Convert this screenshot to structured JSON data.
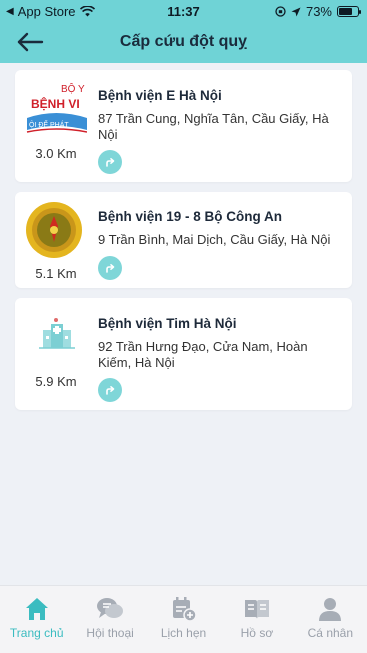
{
  "status": {
    "carrier": "App Store",
    "time": "11:37",
    "battery": "73%"
  },
  "header": {
    "title": "Cấp cứu đột quỵ"
  },
  "hospitals": [
    {
      "name": "Bệnh viện E Hà Nội",
      "address": "87 Trần Cung, Nghĩa Tân, Cầu Giấy, Hà Nội",
      "distance": "3.0 Km",
      "logo_top": "BỘ Y",
      "logo_mid": "BỆNH VI",
      "logo_bot": "ỘI ĐỂ PHÁT"
    },
    {
      "name": "Bệnh viện 19 - 8 Bộ Công An",
      "address": "9 Trần Bình, Mai Dịch, Cầu Giấy, Hà Nội",
      "distance": "5.1 Km"
    },
    {
      "name": "Bệnh viện Tim Hà Nội",
      "address": "92 Trần Hưng Đạo, Cửa Nam, Hoàn Kiếm, Hà Nội",
      "distance": "5.9 Km"
    }
  ],
  "tabs": [
    {
      "label": "Trang chủ",
      "icon": "home-icon"
    },
    {
      "label": "Hội thoại",
      "icon": "chat-icon"
    },
    {
      "label": "Lịch hẹn",
      "icon": "calendar-add-icon"
    },
    {
      "label": "Hồ sơ",
      "icon": "book-icon"
    },
    {
      "label": "Cá nhân",
      "icon": "person-icon"
    }
  ],
  "colors": {
    "accent": "#6fd3d6",
    "active_tab": "#3bbcc0",
    "inactive_tab": "#9aa0aa"
  }
}
